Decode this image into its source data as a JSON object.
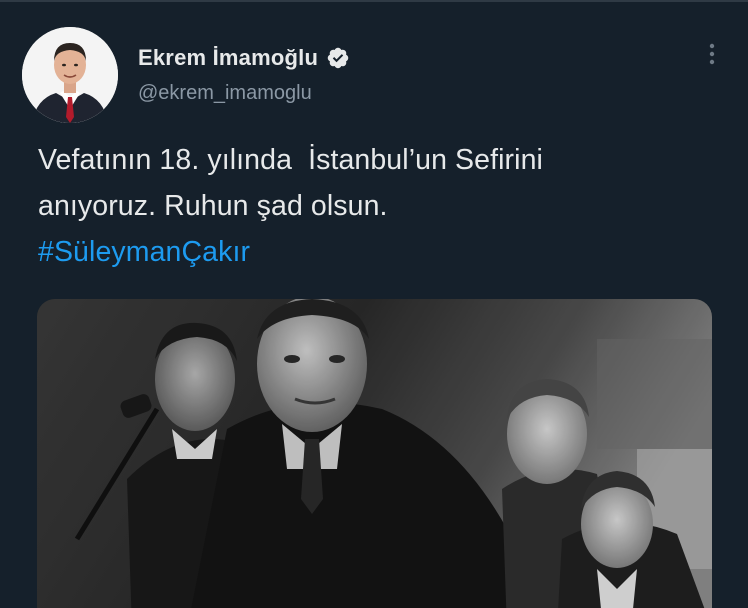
{
  "tweet": {
    "author": {
      "display_name": "Ekrem İmamoğlu",
      "handle": "@ekrem_imamoglu",
      "verified": true,
      "avatar_icon": "profile-photo"
    },
    "text_lines": [
      "Vefatının 18. yılında  İstanbul’un Sefirini",
      "anıyoruz. Ruhun şad olsun."
    ],
    "hashtag": "#SüleymanÇakır",
    "media": {
      "kind": "black-and-white-video-frame"
    },
    "more_icon": "more-dots-vertical-icon"
  },
  "theme": {
    "background": "#15202b",
    "text": "#e7e9ea",
    "secondary_text": "#8b98a5",
    "link": "#1d9bf0",
    "verified_badge": "#e7e9ea"
  }
}
